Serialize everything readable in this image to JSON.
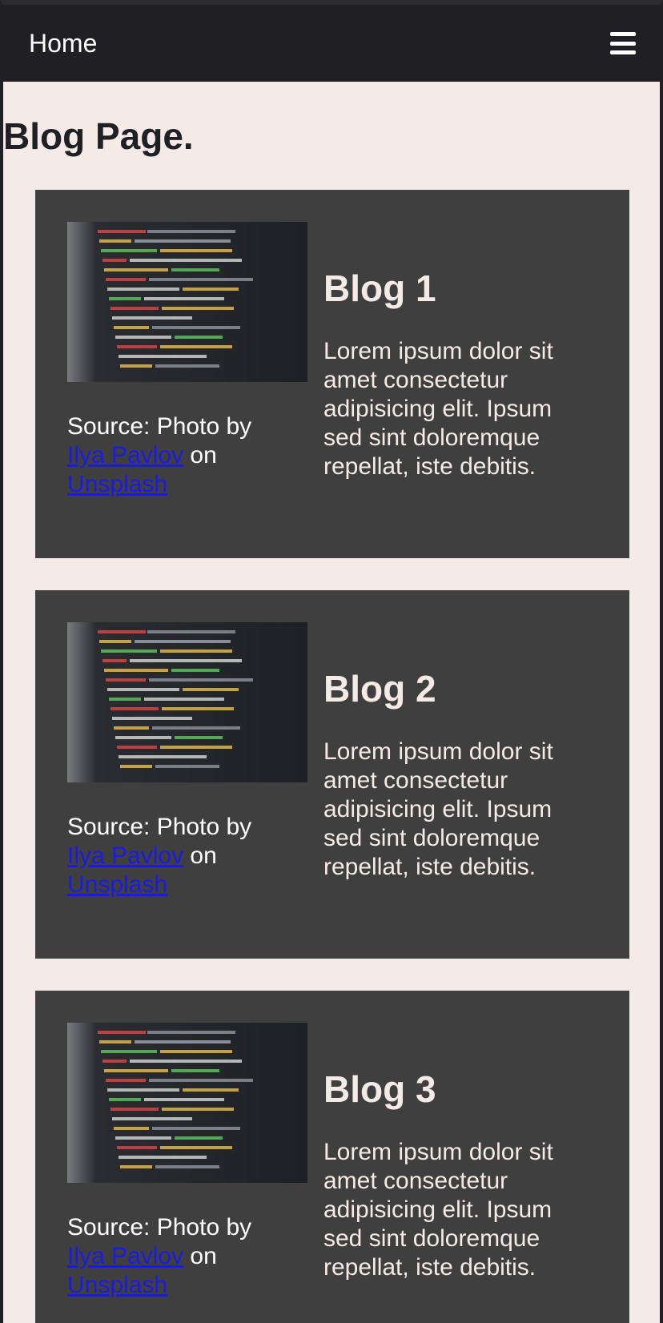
{
  "nav": {
    "home_label": "Home",
    "menu_icon": "hamburger-menu-icon"
  },
  "page": {
    "title": "Blog Page."
  },
  "blogs": [
    {
      "title": "Blog 1",
      "text": "Lorem ipsum dolor sit amet consectetur adipisicing elit. Ipsum sed sint doloremque repellat, iste debitis.",
      "source_prefix": "Source: Photo by",
      "author_link": "Ilya Pavlov",
      "source_mid": "on",
      "site_link": "Unsplash"
    },
    {
      "title": "Blog 2",
      "text": "Lorem ipsum dolor sit amet consectetur adipisicing elit. Ipsum sed sint doloremque repellat, iste debitis.",
      "source_prefix": "Source: Photo by",
      "author_link": "Ilya Pavlov",
      "source_mid": "on",
      "site_link": "Unsplash"
    },
    {
      "title": "Blog 3",
      "text": "Lorem ipsum dolor sit amet consectetur adipisicing elit. Ipsum sed sint doloremque repellat, iste debitis.",
      "source_prefix": "Source: Photo by",
      "author_link": "Ilya Pavlov",
      "source_mid": "on",
      "site_link": "Unsplash"
    }
  ],
  "colors": {
    "navbar_bg": "#1f1f24",
    "page_bg": "#f4ebe8",
    "card_bg": "#403f3f",
    "link": "#1a1ae6"
  }
}
